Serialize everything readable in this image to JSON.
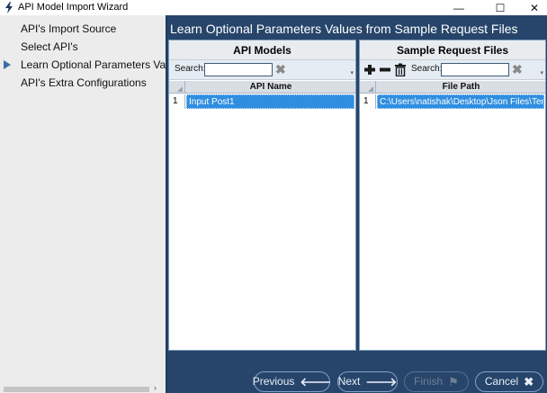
{
  "window": {
    "title": "API Model Import Wizard",
    "controls": {
      "minimize": "—",
      "maximize": "☐",
      "close": "✕"
    }
  },
  "sidebar": {
    "items": [
      {
        "label": "API's Import Source",
        "active": false
      },
      {
        "label": "Select API's",
        "active": false
      },
      {
        "label": "Learn Optional Parameters Values",
        "active": true
      },
      {
        "label": "API's Extra Configurations",
        "active": false
      }
    ]
  },
  "main": {
    "header": "Learn Optional Parameters Values from Sample Request Files",
    "left_panel": {
      "title": "API Models",
      "search_label": "Search:",
      "search_value": "",
      "grid": {
        "columns": [
          "API Name"
        ],
        "rows": [
          {
            "num": "1",
            "cells": [
              "Input Post1"
            ],
            "selected": true
          }
        ]
      }
    },
    "right_panel": {
      "title": "Sample Request Files",
      "search_label": "Search:",
      "search_value": "",
      "toolbar_icons": [
        "add-icon",
        "remove-icon",
        "delete-icon"
      ],
      "grid": {
        "columns": [
          "File Path"
        ],
        "rows": [
          {
            "num": "1",
            "cells": [
              "C:\\Users\\natishak\\Desktop\\Json Files\\Templat"
            ],
            "selected": true
          }
        ]
      }
    }
  },
  "footer": {
    "previous": "Previous",
    "next": "Next",
    "finish": "Finish",
    "cancel": "Cancel"
  },
  "colors": {
    "header_bg": "#27456b",
    "selection": "#2f8ee0",
    "sidebar_bg": "#ececec",
    "active_arrow": "#3b6ea8"
  }
}
